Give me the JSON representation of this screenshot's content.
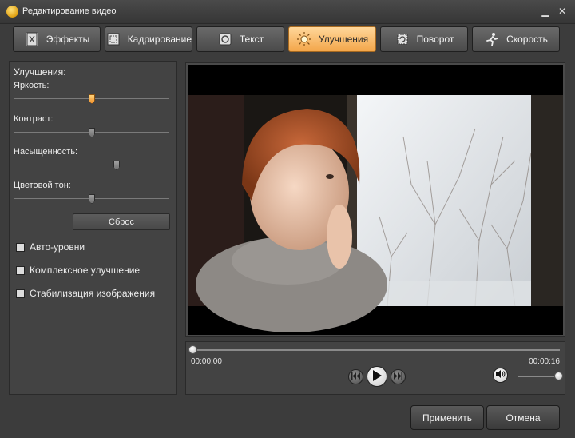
{
  "window": {
    "title": "Редактирование видео",
    "minimize": "▁",
    "close": "✕"
  },
  "tabs": [
    {
      "label": "Эффекты",
      "icon": "effects-icon",
      "active": false
    },
    {
      "label": "Кадрирование",
      "icon": "crop-icon",
      "active": false
    },
    {
      "label": "Текст",
      "icon": "text-icon",
      "active": false
    },
    {
      "label": "Улучшения",
      "icon": "enhance-icon",
      "active": true
    },
    {
      "label": "Поворот",
      "icon": "rotate-icon",
      "active": false
    },
    {
      "label": "Скорость",
      "icon": "speed-icon",
      "active": false
    }
  ],
  "enhance": {
    "heading": "Улучшения:",
    "sliders": [
      {
        "label": "Яркость:",
        "value": 0.5,
        "highlighted": true
      },
      {
        "label": "Контраст:",
        "value": 0.5,
        "highlighted": false
      },
      {
        "label": "Насыщенность:",
        "value": 0.67,
        "highlighted": false
      },
      {
        "label": "Цветовой тон:",
        "value": 0.5,
        "highlighted": false
      }
    ],
    "reset_label": "Сброс",
    "checkboxes": [
      {
        "label": "Авто-уровни",
        "checked": false
      },
      {
        "label": "Комплексное улучшение",
        "checked": false
      },
      {
        "label": "Стабилизация изображения",
        "checked": false
      }
    ]
  },
  "player": {
    "current_time": "00:00:00",
    "total_time": "00:00:16",
    "progress": 0.0,
    "volume": 1.0
  },
  "buttons": {
    "apply": "Применить",
    "cancel": "Отмена"
  },
  "colors": {
    "accent": "#f3a64a",
    "background": "#3c3c3c"
  }
}
